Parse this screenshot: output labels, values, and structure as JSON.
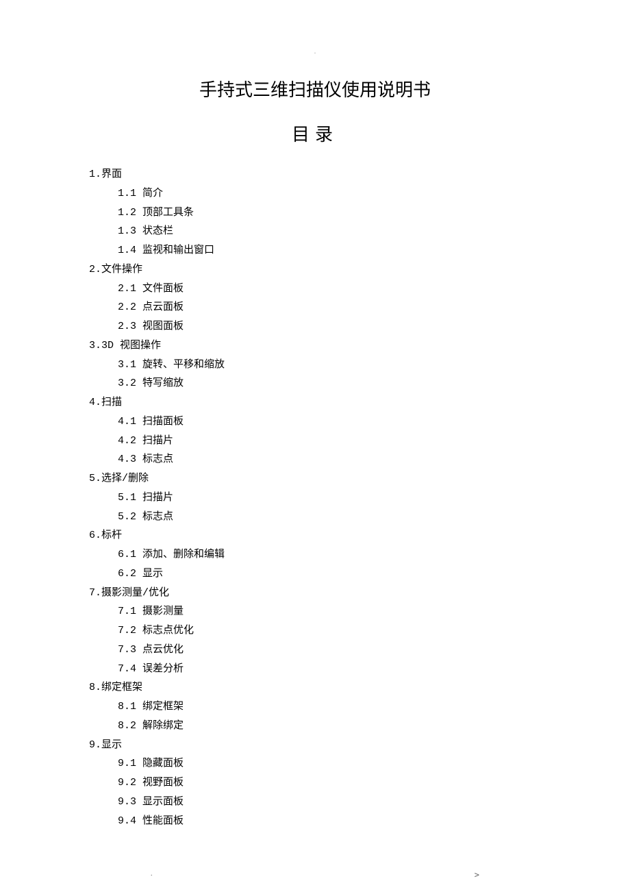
{
  "doc_title": "手持式三维扫描仪使用说明书",
  "toc_heading": "目录",
  "top_dot": ".",
  "footer_left": ".",
  "footer_right": ">",
  "sections": [
    {
      "num": "1.",
      "title": "界面",
      "items": [
        {
          "num": "1.1",
          "label": "简介"
        },
        {
          "num": "1.2",
          "label": "顶部工具条"
        },
        {
          "num": "1.3",
          "label": "状态栏"
        },
        {
          "num": "1.4",
          "label": "监视和输出窗口"
        }
      ]
    },
    {
      "num": "2.",
      "title": "文件操作",
      "items": [
        {
          "num": "2.1",
          "label": "文件面板"
        },
        {
          "num": "2.2",
          "label": "点云面板"
        },
        {
          "num": "2.3",
          "label": "视图面板"
        }
      ]
    },
    {
      "num": "3.",
      "title": "3D 视图操作",
      "items": [
        {
          "num": "3.1",
          "label": "旋转、平移和缩放"
        },
        {
          "num": "3.2",
          "label": "特写缩放"
        }
      ]
    },
    {
      "num": "4.",
      "title": "扫描",
      "items": [
        {
          "num": "4.1",
          "label": "扫描面板"
        },
        {
          "num": "4.2",
          "label": "扫描片"
        },
        {
          "num": "4.3",
          "label": "标志点"
        }
      ]
    },
    {
      "num": "5.",
      "title": "选择/删除",
      "items": [
        {
          "num": "5.1",
          "label": "扫描片"
        },
        {
          "num": "5.2",
          "label": "标志点"
        }
      ]
    },
    {
      "num": "6.",
      "title": "标杆",
      "items": [
        {
          "num": "6.1",
          "label": "添加、删除和编辑"
        },
        {
          "num": "6.2",
          "label": "显示"
        }
      ]
    },
    {
      "num": "7.",
      "title": "摄影测量/优化",
      "items": [
        {
          "num": "7.1",
          "label": "摄影测量"
        },
        {
          "num": "7.2",
          "label": "标志点优化"
        },
        {
          "num": "7.3",
          "label": "点云优化"
        },
        {
          "num": "7.4",
          "label": "误差分析"
        }
      ]
    },
    {
      "num": "8.",
      "title": "绑定框架",
      "items": [
        {
          "num": "8.1",
          "label": "绑定框架"
        },
        {
          "num": "8.2",
          "label": "解除绑定"
        }
      ]
    },
    {
      "num": "9.",
      "title": "显示",
      "items": [
        {
          "num": "9.1",
          "label": "隐藏面板"
        },
        {
          "num": "9.2",
          "label": "视野面板"
        },
        {
          "num": "9.3",
          "label": "显示面板"
        },
        {
          "num": "9.4",
          "label": "性能面板"
        }
      ]
    }
  ]
}
